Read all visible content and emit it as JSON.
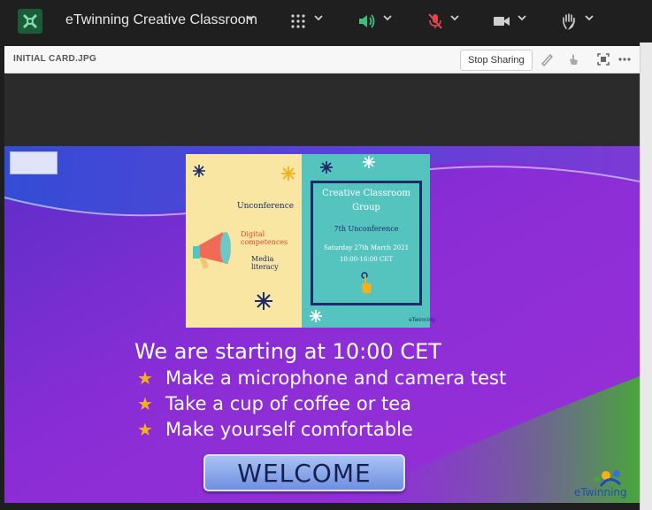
{
  "topbar": {
    "app_title": "eTwinning Creative Classroom",
    "icons": [
      "app-logo-icon",
      "grid-icon",
      "speaker-icon",
      "mic-muted-icon",
      "camera-icon",
      "raise-hand-icon"
    ],
    "colors": {
      "speaker": "#3fbf7f",
      "mic_muted": "#e0464e"
    }
  },
  "panel": {
    "file_title": "INITIAL CARD.JPG",
    "stop_sharing_label": "Stop Sharing"
  },
  "slide": {
    "heading": "We are starting at 10:00 CET",
    "bullets": [
      "Make a microphone and camera test",
      "Take a cup of coffee or tea",
      "Make yourself comfortable"
    ],
    "welcome_label": "WELCOME",
    "poster": {
      "left_words": [
        "Unconference",
        "Digital competences",
        "Media literacy"
      ],
      "group_title_line1": "Creative Classroom",
      "group_title_line2": "Group",
      "event": "7th Unconference",
      "date": "Saturday 27th March 2021",
      "time": "10:00-16:00 CET",
      "brand": "eTwinning"
    },
    "footer_brand": "eTwinning"
  }
}
